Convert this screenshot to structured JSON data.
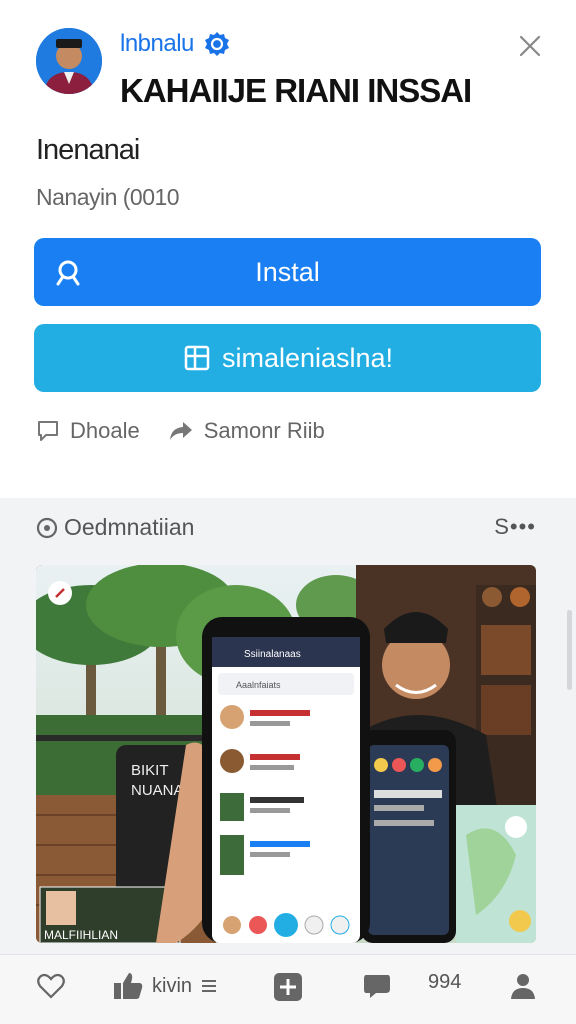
{
  "header": {
    "app_name": "lnbnalu",
    "headline": "KAHAIIJE RIANI INSSAI",
    "subtitle": "Inenanai",
    "meta": "Nanayin (0010"
  },
  "buttons": {
    "install_label": "Instal",
    "secondary_label": "simaleniaslna!"
  },
  "actions": {
    "comment_label": "Dhoale",
    "share_label": "Samonr Riib"
  },
  "feed": {
    "section_label": "Oedmnatiian",
    "more_label": "S•••"
  },
  "media": {
    "sign_text_1": "BIKIT",
    "sign_text_2": "NUANAI",
    "thumb_caption": "MALFIIHLIAN",
    "phone_header": "Ssiinalanaas",
    "phone_subheader": "Aaalnfaiats"
  },
  "bottom_nav": {
    "like_label": "kivin",
    "count_label": "994"
  },
  "colors": {
    "primary_blue": "#1a7ff2",
    "secondary_cyan": "#23aee3",
    "brand_text_blue": "#1a73e8"
  }
}
